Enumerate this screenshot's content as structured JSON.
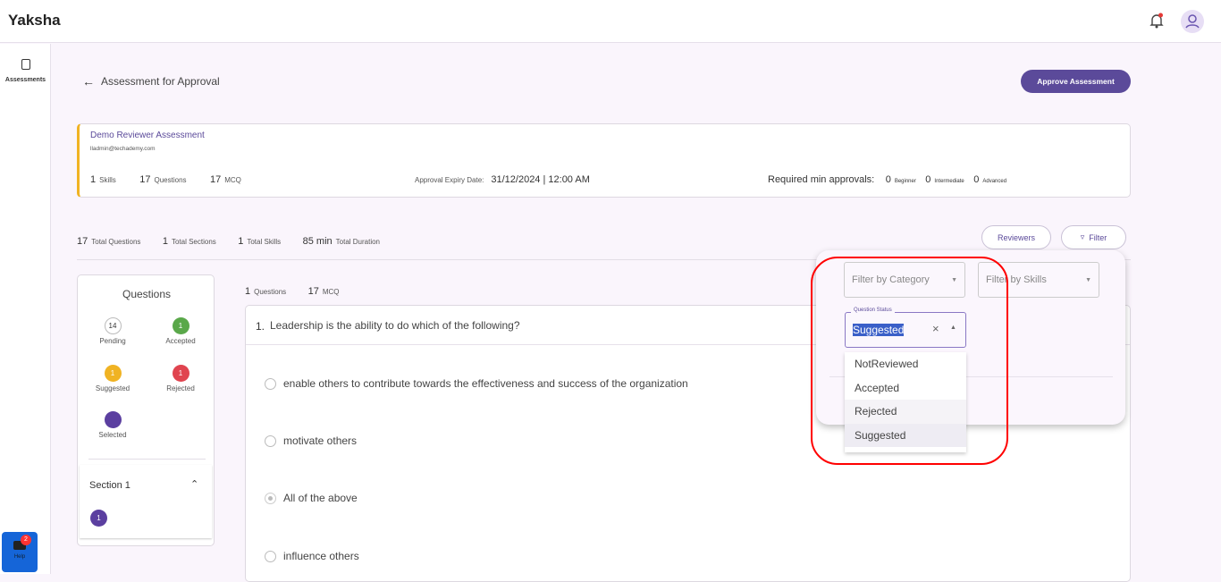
{
  "app": {
    "title": "Yaksha"
  },
  "sidebar": {
    "items": [
      {
        "label": "Assessments"
      }
    ]
  },
  "help": {
    "label": "Help",
    "badge": "2"
  },
  "header": {
    "back_title": "Assessment for Approval",
    "approve_label": "Approve Assessment"
  },
  "assessment": {
    "name": "Demo Reviewer Assessment",
    "email": "lladmin@techademy.com",
    "skills": "1",
    "skills_label": "Skills",
    "questions": "17",
    "questions_label": "Questions",
    "mcq": "17",
    "mcq_label": "MCQ",
    "expiry_label": "Approval Expiry Date:",
    "expiry_value": "31/12/2024 | 12:00 AM",
    "approvals_label": "Required min approvals:",
    "approvals": [
      {
        "value": "0",
        "label": "Beginner"
      },
      {
        "value": "0",
        "label": "Intermediate"
      },
      {
        "value": "0",
        "label": "Advanced"
      }
    ]
  },
  "totals": [
    {
      "value": "17",
      "label": "Total Questions"
    },
    {
      "value": "1",
      "label": "Total Sections"
    },
    {
      "value": "1",
      "label": "Total Skills"
    },
    {
      "value": "85 min",
      "label": "Total Duration"
    }
  ],
  "toolbar": {
    "reviewers_label": "Reviewers",
    "filter_label": "Filter"
  },
  "questions_panel": {
    "title": "Questions",
    "legend": [
      {
        "count": "14",
        "label": "Pending",
        "color": "#ffffff"
      },
      {
        "count": "1",
        "label": "Accepted",
        "color": "#5aa84a"
      },
      {
        "count": "1",
        "label": "Suggested",
        "color": "#f0b323"
      },
      {
        "count": "1",
        "label": "Rejected",
        "color": "#e0444f"
      },
      {
        "count": "",
        "label": "Selected",
        "color": "#5b3fa0"
      }
    ],
    "section": {
      "label": "Section 1",
      "questions": [
        "1"
      ]
    }
  },
  "question_meta": {
    "count": "1",
    "count_label": "Questions",
    "mcq": "17",
    "mcq_label": "MCQ"
  },
  "question": {
    "number": "1.",
    "text": "Leadership is the ability to do which of the following?",
    "options": [
      "enable others to contribute towards the effectiveness and success of the organization",
      "motivate others",
      "All of the above",
      "influence others"
    ],
    "selected_index": 2
  },
  "filter": {
    "category_placeholder": "Filter by Category",
    "skills_placeholder": "Filter by Skills",
    "status_label": "Question Status",
    "status_value": "Suggested",
    "status_options": [
      "NotReviewed",
      "Accepted",
      "Rejected",
      "Suggested"
    ]
  },
  "colors": {
    "accent": "#5b4a9a",
    "highlight": "#ff0000"
  }
}
